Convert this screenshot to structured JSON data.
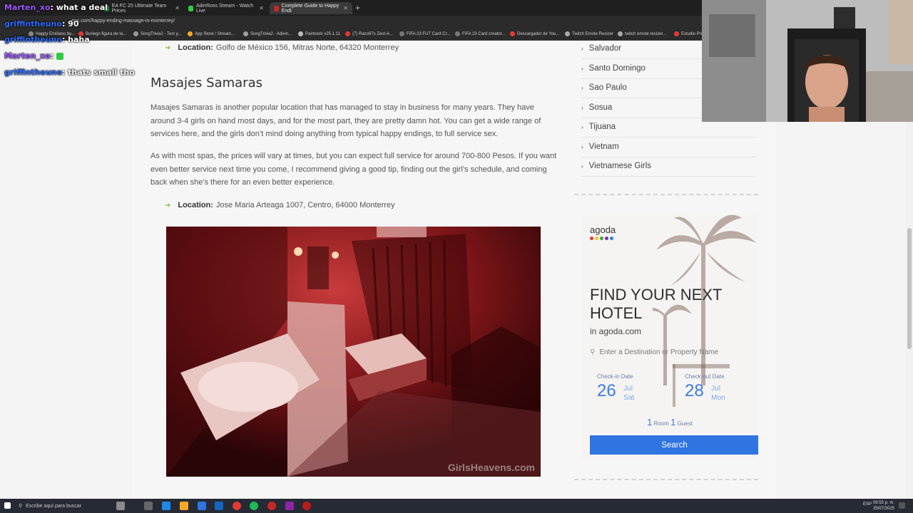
{
  "browser": {
    "tabs": [
      {
        "label": "EA FC 25 Ultimate Team Prices",
        "color": "#1f8f3a",
        "active": false
      },
      {
        "label": "AdinRoss Stream - Watch Live",
        "color": "#2ecc40",
        "active": false
      },
      {
        "label": "Complete Guide to Happy Endi",
        "color": "#c62828",
        "active": true
      }
    ],
    "url": "ens.com/happy-ending-massage-in-monterrey/",
    "bookmarks": [
      {
        "label": "Happy Emiliano by...",
        "color": "#888888"
      },
      {
        "label": "Buriego figura de la...",
        "color": "#e53935"
      },
      {
        "label": "SongTrivia2 - Test y...",
        "color": "#999999"
      },
      {
        "label": "App Store / Stream...",
        "color": "#f9a825"
      },
      {
        "label": "SongTrivia2 - Adivin...",
        "color": "#9e9e9e"
      },
      {
        "label": "Paintools v25.1.11",
        "color": "#bbbbbb"
      },
      {
        "label": "(7) Razo97s Zest-A...",
        "color": "#e53935"
      },
      {
        "label": "FIFA 23 FUT Card Cr...",
        "color": "#777777"
      },
      {
        "label": "FIFA 23 Card creator...",
        "color": "#777777"
      },
      {
        "label": "Descargador de You...",
        "color": "#e53935"
      },
      {
        "label": "Twitch Emote Resizer",
        "color": "#aaaaaa"
      },
      {
        "label": "twitch emote resizer...",
        "color": "#aaaaaa"
      },
      {
        "label": "Estudio Pri",
        "color": "#e53935"
      }
    ]
  },
  "chat": [
    {
      "user": "Marten_xo",
      "text": ": what a deal"
    },
    {
      "user": "griffintheuno",
      "text": ": 90"
    },
    {
      "user": "griffintheuno",
      "text": ": haha"
    },
    {
      "user": "Marten_xo",
      "text": ":"
    },
    {
      "user": "griffintheuno",
      "text": ": thats small tho"
    }
  ],
  "article": {
    "location_top_label": "Location:",
    "location_top_value": "Golfo de México 156, Mitras Norte, 64320 Monterrey",
    "heading": "Masajes Samaras",
    "para1": "Masajes Samaras is another popular location that has managed to stay in business for many years. They have around 3-4 girls on hand most days, and for the most part, they are pretty damn hot. You can get a wide range of services here, and the girls don’t mind doing anything from typical happy endings, to full service sex.",
    "para2": "As with most spas, the prices will vary at times, but you can expect full service for around 700-800 Pesos. If you want even better service next time you come, I recommend giving a good tip, finding out the girl’s schedule, and coming back when she’s there for an even better experience.",
    "location2_label": "Location:",
    "location2_value": "Jose Maria Arteaga 1007, Centro, 64000 Monterrey",
    "watermark": "GirlsHeavens.com"
  },
  "sidebar": {
    "items": [
      {
        "label": "Salvador"
      },
      {
        "label": "Santo Domingo"
      },
      {
        "label": "Sao Paulo"
      },
      {
        "label": "Sosua"
      },
      {
        "label": "Tijuana"
      },
      {
        "label": "Vietnam"
      },
      {
        "label": "Vietnamese Girls"
      }
    ]
  },
  "agoda": {
    "logo": "agoda",
    "headline": "FIND YOUR NEXT HOTEL",
    "sub": "in agoda.com",
    "placeholder": "Enter a Destination or Property Name",
    "checkin_label": "Check-in Date",
    "checkin_day": "26",
    "checkin_month": "Jul",
    "checkin_weekday": "Sat",
    "checkout_label": "Check-out Date",
    "checkout_day": "28",
    "checkout_month": "Jul",
    "checkout_weekday": "Mon",
    "rooms": "1",
    "rooms_label": "Room",
    "guests": "1",
    "guests_label": "Guest",
    "button": "Search",
    "dot_colors": [
      "#e53935",
      "#fbc02d",
      "#43a047",
      "#8e24aa",
      "#1e88e5"
    ]
  },
  "taskbar": {
    "search_placeholder": "Escribe aquí para buscar",
    "lang": "ESP",
    "time": "09:55 p. m.",
    "date": "25/07/2025"
  }
}
